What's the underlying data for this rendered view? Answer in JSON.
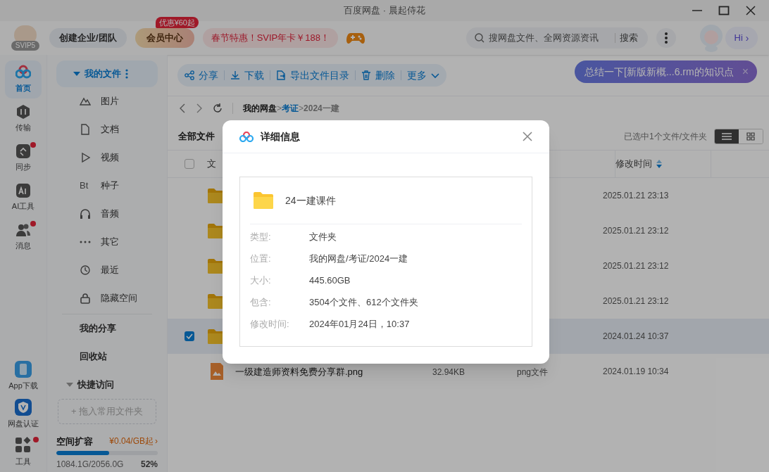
{
  "window": {
    "title": "百度网盘 · 晨起侍花"
  },
  "header": {
    "vip_level": "SVIP5",
    "team_button": "创建企业/团队",
    "member_button": "会员中心",
    "member_badge": "优惠¥60起",
    "promo": "春节特惠！SVIP年卡￥188！",
    "search": {
      "placeholder": "搜网盘文件、全网资源资讯",
      "button": "搜索"
    },
    "assistant": "Hi",
    "assistant_chevron": "›"
  },
  "toast": {
    "text": "总结一下[新版新概...6.rm的知识点",
    "close": "×"
  },
  "rail": [
    {
      "label": "首页",
      "selected": true,
      "dot": false
    },
    {
      "label": "传输",
      "selected": false,
      "dot": false
    },
    {
      "label": "同步",
      "selected": false,
      "dot": true
    },
    {
      "label": "AI工具",
      "selected": false,
      "dot": false
    },
    {
      "label": "消息",
      "selected": false,
      "dot": true
    }
  ],
  "rail_bottom": [
    {
      "label": "App下载",
      "dot": false
    },
    {
      "label": "网盘认证",
      "dot": false
    },
    {
      "label": "工具",
      "dot": true
    }
  ],
  "sidebar": {
    "my_files": {
      "label": "我的文件",
      "expanded": true
    },
    "categories": [
      {
        "label": "图片",
        "selected": false
      },
      {
        "label": "文档",
        "selected": false
      },
      {
        "label": "视频",
        "selected": false
      },
      {
        "label": "种子",
        "selected": false,
        "glyph": "Bt"
      },
      {
        "label": "音频",
        "selected": false
      },
      {
        "label": "其它",
        "selected": false
      },
      {
        "label": "最近",
        "selected": false
      },
      {
        "label": "隐藏空间",
        "selected": false
      }
    ],
    "links": [
      "我的分享",
      "回收站"
    ],
    "quick_access": {
      "label": "快捷访问",
      "expanded": true,
      "drop_hint": "+ 拖入常用文件夹"
    },
    "storage": {
      "title": "空间扩容",
      "offer": "¥0.04/GB起",
      "offer_chevron": "›",
      "level": 0.52,
      "usage": "1084.1G/2056.0G",
      "percent": "52%"
    }
  },
  "toolbar": [
    {
      "label": "分享"
    },
    {
      "label": "下载"
    },
    {
      "label": "导出文件目录"
    },
    {
      "label": "删除"
    },
    {
      "label": "更多",
      "dropdown": true
    }
  ],
  "breadcrumb": [
    {
      "label": "我的网盘",
      "sep": ">",
      "kind": "root"
    },
    {
      "label": "考证",
      "sep": ">",
      "kind": "link"
    },
    {
      "label": "2024一建",
      "kind": "current"
    }
  ],
  "list_title": "全部文件",
  "selection_info": "已选中1个文件/文件夹",
  "view": [
    {
      "selected": true
    },
    {
      "selected": false
    }
  ],
  "table": {
    "all_checked": false,
    "columns": [
      "文",
      "修改时间"
    ],
    "rows": [
      {
        "kind": "folder",
        "selected": false,
        "modified": "2025.01.21 23:13"
      },
      {
        "kind": "folder",
        "selected": false,
        "modified": "2025.01.21 23:12"
      },
      {
        "kind": "folder",
        "selected": false,
        "modified": "2025.01.21 23:12"
      },
      {
        "kind": "folder",
        "selected": false,
        "modified": "2025.01.21 23:12"
      },
      {
        "kind": "folder",
        "selected": true,
        "modified": "2024.01.24 10:37"
      },
      {
        "kind": "image",
        "selected": false,
        "name": "一级建造师资料免费分享群.png",
        "size": "32.94KB",
        "type": "png文件",
        "modified": "2024.01.19 10:34"
      }
    ]
  },
  "dialog": {
    "title": "详细信息",
    "name": "24一建课件",
    "fields": [
      {
        "label": "类型:",
        "value": "文件夹"
      },
      {
        "label": "位置:",
        "value": "我的网盘/考证/2024一建"
      },
      {
        "label": "大小:",
        "value": "445.60GB"
      },
      {
        "label": "包含:",
        "value": "3504个文件、612个文件夹"
      },
      {
        "label": "修改时间:",
        "value": "2024年01月24日，10:37"
      }
    ]
  }
}
